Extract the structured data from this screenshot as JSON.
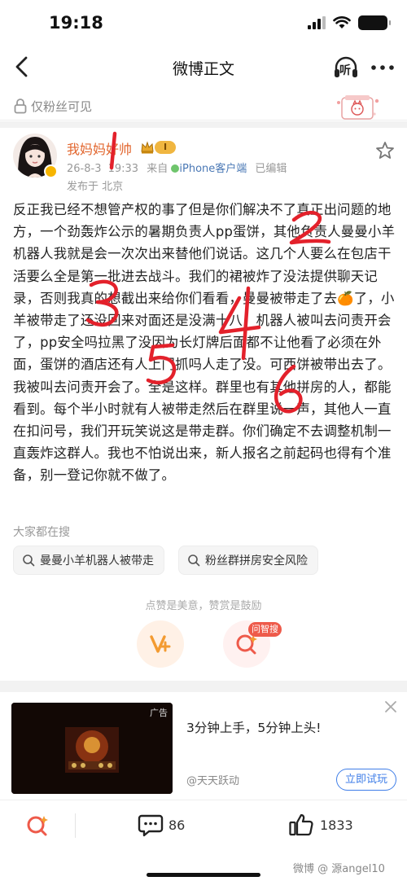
{
  "status_bar": {
    "time": "19:18"
  },
  "nav": {
    "title": "微博正文",
    "listen_icon_text": "听"
  },
  "fans_only": {
    "label": "仅粉丝可见"
  },
  "author": {
    "name": "我妈妈好帅",
    "badge_text": "I",
    "timestamp": "26-8-3",
    "time": "19:33",
    "via_prefix": "来自",
    "client": "iPhone客户端",
    "edited": "已编辑",
    "location": "发布于 北京"
  },
  "post": {
    "text": "反正我已经不想管产权的事了但是你们解决不了真正出问题的地方，一个劲轰炸公示的暑期负责人pp蛋饼，其他负责人曼曼小羊机器人我就是会一次次出来替他们说话。这几个人要么在包店干活要么全是第一批进去战斗。我们的裙被炸了没法提供聊天记录，否则我真的想截出来给你们看看，曼曼被带走了去🍊了，小羊被带走了还没回来对面还是没满十八，机器人被叫去问责开会了，pp安全吗拉黑了没因为长灯牌后面都不让他看了必须在外面，蛋饼的酒店还有人上门抓吗人走了没。可西饼被带出去了。我被叫去问责开会了。全是这样。群里也有其他拼房的人，都能看到。每个半小时就有人被带走然后在群里说一声，其他人一直在扣问号，我们开玩笑说这是带走群。你们确定不去调整机制一直轰炸这群人。我也不怕说出来，新人报名之前起码也得有个准备，别一登记你就不做了。"
  },
  "handwriting_marks": [
    "1",
    "2",
    "3",
    "4",
    "5",
    "6"
  ],
  "related_search": {
    "label": "大家都在搜",
    "items": [
      "曼曼小羊机器人被带走",
      "粉丝群拼房安全风险"
    ]
  },
  "reward": {
    "tip": "点赞是美意，赞赏是鼓励",
    "ask_tag": "问智搜"
  },
  "ad": {
    "label": "广告",
    "headline": "3分钟上手，5分钟上头!",
    "source": "@天天跃动",
    "cta": "立即试玩"
  },
  "bottom_bar": {
    "comments": "86",
    "likes": "1833"
  },
  "watermark": "微博 @ 源angel10",
  "colors": {
    "author_name": "#e2662e",
    "client_link": "#4a78b5",
    "handwriting": "#e3212b",
    "cta_blue": "#3f7ee8",
    "reward_orange": "#f39b31",
    "ask_red": "#ee5a4a"
  }
}
